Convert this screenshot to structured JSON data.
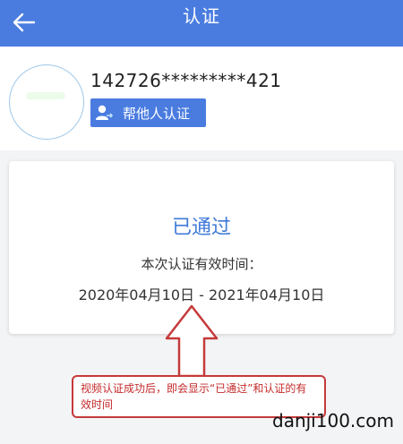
{
  "header": {
    "title": "认证",
    "back_icon": "arrow-left-icon",
    "background_color": "#4a7ce0"
  },
  "profile": {
    "id_number": "142726*********421",
    "help_button_label": "帮他人认证",
    "help_button_icon": "user-transfer-icon"
  },
  "status_card": {
    "status": "已通过",
    "valid_label": "本次认证有效时间：",
    "valid_range": "2020年04月10日 - 2021年04月10日",
    "status_color": "#3f7ad8"
  },
  "annotation": {
    "note": "视频认证成功后，即会显示“已通过”和认证的有效时间",
    "color": "#c53a3a"
  },
  "watermark": "danji100.com"
}
